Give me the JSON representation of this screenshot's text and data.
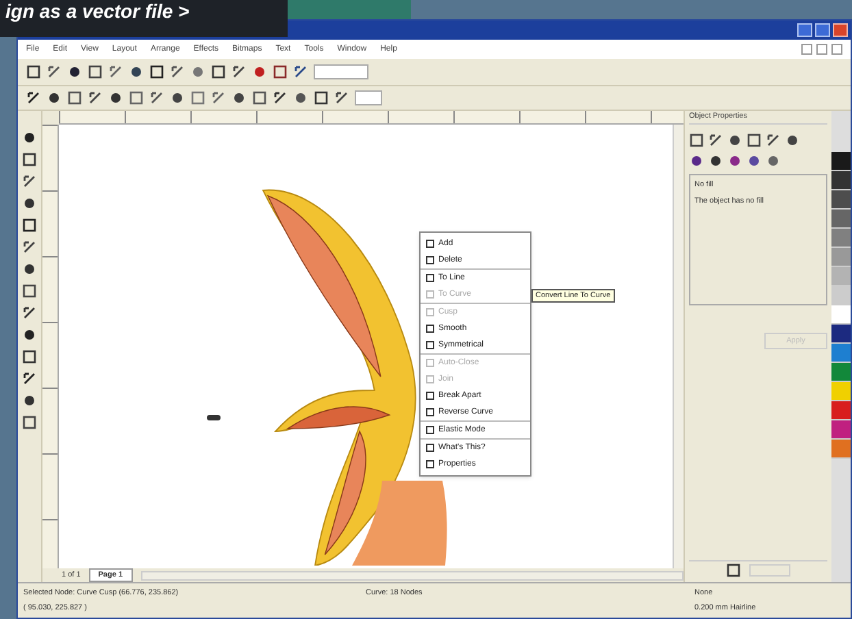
{
  "caption": "ign as a vector file >",
  "menu": [
    "File",
    "Edit",
    "View",
    "Layout",
    "Arrange",
    "Effects",
    "Bitmaps",
    "Text",
    "Tools",
    "Window",
    "Help"
  ],
  "page_tabs": {
    "counter": "1 of 1",
    "tabs": [
      {
        "label": "Page 1",
        "selected": true
      }
    ]
  },
  "context_menu": {
    "groups": [
      [
        {
          "label": "Add",
          "disabled": false
        },
        {
          "label": "Delete",
          "disabled": false
        }
      ],
      [
        {
          "label": "To Line",
          "disabled": false
        },
        {
          "label": "To Curve",
          "disabled": true
        }
      ],
      [
        {
          "label": "Cusp",
          "disabled": true
        },
        {
          "label": "Smooth",
          "disabled": false
        },
        {
          "label": "Symmetrical",
          "disabled": false
        }
      ],
      [
        {
          "label": "Auto-Close",
          "disabled": true
        },
        {
          "label": "Join",
          "disabled": true
        },
        {
          "label": "Break Apart",
          "disabled": false
        },
        {
          "label": "Reverse Curve",
          "disabled": false
        }
      ],
      [
        {
          "label": "Elastic Mode",
          "disabled": false
        }
      ],
      [
        {
          "label": "What's This?",
          "disabled": false
        },
        {
          "label": "Properties",
          "disabled": false
        }
      ]
    ]
  },
  "tooltip": "Convert Line To Curve",
  "docker": {
    "title": "Object Properties",
    "group_label": "No fill",
    "message": "The object has no fill",
    "apply": {
      "label": "Apply",
      "disabled": true
    }
  },
  "palette": [
    {
      "color": "#1a1a1a"
    },
    {
      "color": "#333333"
    },
    {
      "color": "#4d4d4d"
    },
    {
      "color": "#666666"
    },
    {
      "color": "#808080"
    },
    {
      "color": "#999999"
    },
    {
      "color": "#b3b3b3"
    },
    {
      "color": "#cccccc"
    },
    {
      "color": "#ffffff"
    },
    {
      "color": "#1c2a80"
    },
    {
      "color": "#1e7fd0"
    },
    {
      "color": "#12883a"
    },
    {
      "color": "#f0d000"
    },
    {
      "color": "#d81e1e"
    },
    {
      "color": "#c02080"
    },
    {
      "color": "#e07020"
    }
  ],
  "status_bar": {
    "selection": "Selected Node: Curve Cusp (66.776, 235.862)",
    "nodes": "Curve: 18 Nodes",
    "coords": "( 95.030, 225.827 )",
    "fill": "None",
    "outline": "0.200 mm Hairline"
  }
}
